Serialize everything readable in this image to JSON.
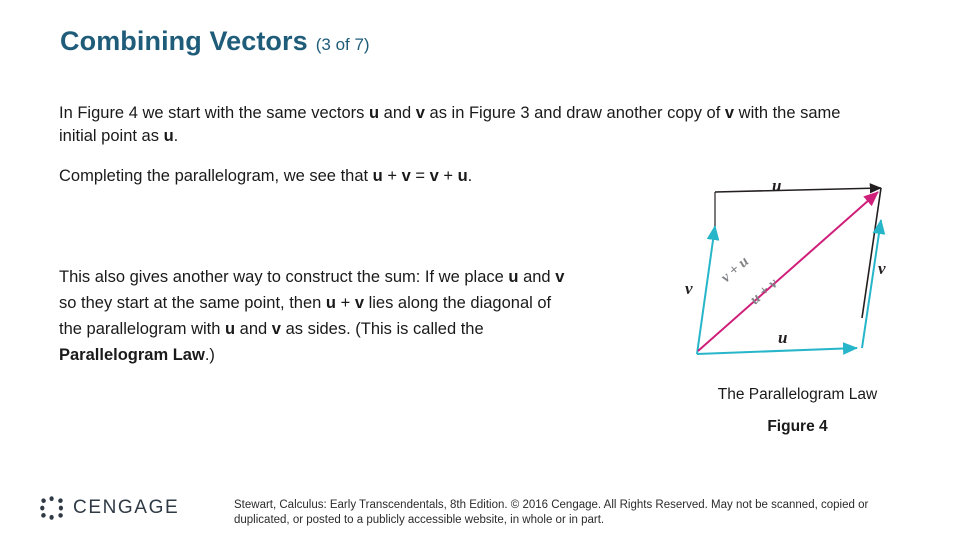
{
  "slide": {
    "title": "Combining Vectors",
    "title_sub": "(3 of 7)",
    "paragraph1_parts": [
      {
        "t": "In Figure 4 we start with the same vectors ",
        "b": false
      },
      {
        "t": "u",
        "b": true
      },
      {
        "t": " and ",
        "b": false
      },
      {
        "t": "v",
        "b": true
      },
      {
        "t": " as in Figure 3 and draw another copy of ",
        "b": false
      },
      {
        "t": "v",
        "b": true
      },
      {
        "t": " with the same initial point as ",
        "b": false
      },
      {
        "t": "u",
        "b": true
      },
      {
        "t": ".",
        "b": false
      }
    ],
    "paragraph2_parts": [
      {
        "t": "Completing the parallelogram, we see that ",
        "b": false
      },
      {
        "t": "u",
        "b": true
      },
      {
        "t": " + ",
        "b": false
      },
      {
        "t": "v",
        "b": true
      },
      {
        "t": " = ",
        "b": false
      },
      {
        "t": "v",
        "b": true
      },
      {
        "t": " + ",
        "b": false
      },
      {
        "t": "u",
        "b": true
      },
      {
        "t": ".",
        "b": false
      }
    ],
    "paragraph3_parts": [
      {
        "t": "This also gives another way to construct the sum: If we place ",
        "b": false
      },
      {
        "t": "u",
        "b": true
      },
      {
        "t": " and ",
        "b": false
      },
      {
        "t": "v",
        "b": true
      },
      {
        "t": " so they start at the same point, then ",
        "b": false
      },
      {
        "t": "u",
        "b": true
      },
      {
        "t": " + ",
        "b": false
      },
      {
        "t": "v",
        "b": true
      },
      {
        "t": " lies along the diagonal of the parallelogram with ",
        "b": false
      },
      {
        "t": "u",
        "b": true
      },
      {
        "t": " and ",
        "b": false
      },
      {
        "t": "v",
        "b": true
      },
      {
        "t": " as sides. (This is called the ",
        "b": false
      },
      {
        "t": "Parallelogram Law",
        "b": true
      },
      {
        "t": ".)",
        "b": false
      }
    ],
    "figure": {
      "caption": "The Parallelogram Law",
      "label": "Figure 4",
      "vector_labels": {
        "top_u": "u",
        "right_v": "v",
        "left_v": "v",
        "bottom_u": "u",
        "diag_upper": "v + u",
        "diag_lower": "u + v"
      },
      "colors": {
        "black_vector": "#231f20",
        "teal_vector": "#27b6c9",
        "diagonal": "#cf1f7a",
        "gray_label": "#6d6e71"
      }
    },
    "footer": "Stewart, Calculus: Early Transcendentals, 8th Edition. © 2016 Cengage. All Rights Reserved. May not be scanned, copied or duplicated, or posted to a publicly accessible website, in whole or in part.",
    "logo_text": "CENGAGE",
    "title_color": "#1f5c7a"
  }
}
